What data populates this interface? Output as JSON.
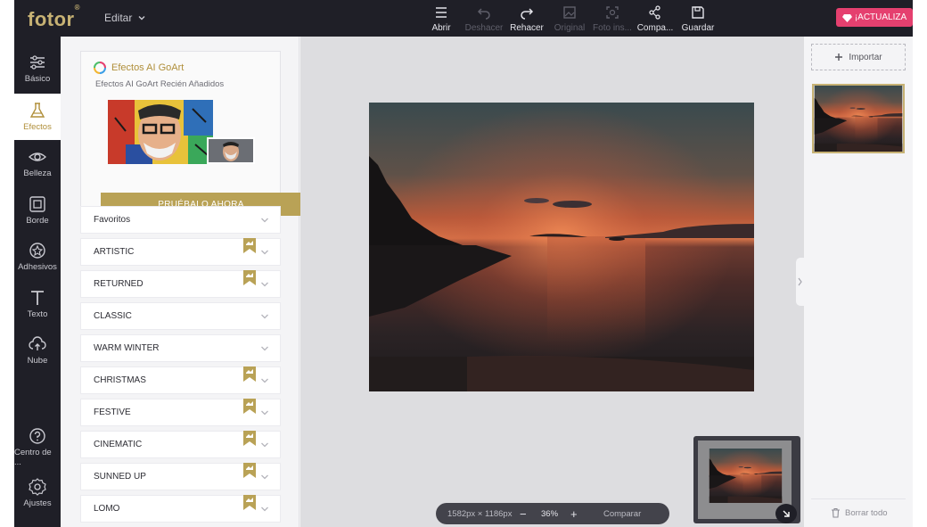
{
  "app": {
    "logo_text": "fotor",
    "logo_mark": "®",
    "edit_menu": "Editar"
  },
  "toolbar": [
    {
      "label": "Abrir",
      "icon": "menu-icon",
      "enabled": true
    },
    {
      "label": "Deshacer",
      "icon": "undo-icon",
      "enabled": false
    },
    {
      "label": "Rehacer",
      "icon": "redo-icon",
      "enabled": true
    },
    {
      "label": "Original",
      "icon": "image-icon",
      "enabled": false
    },
    {
      "label": "Foto ins...",
      "icon": "focus-icon",
      "enabled": false
    },
    {
      "label": "Compa...",
      "icon": "share-icon",
      "enabled": true
    },
    {
      "label": "Guardar",
      "icon": "save-icon",
      "enabled": true
    }
  ],
  "upgrade_label": "¡ACTUALIZA",
  "sidebar": [
    {
      "label": "Básico",
      "icon": "sliders-icon",
      "active": false
    },
    {
      "label": "Efectos",
      "icon": "flask-icon",
      "active": true
    },
    {
      "label": "Belleza",
      "icon": "eye-icon",
      "active": false
    },
    {
      "label": "Borde",
      "icon": "frame-icon",
      "active": false
    },
    {
      "label": "Adhesivos",
      "icon": "sticker-icon",
      "active": false
    },
    {
      "label": "Texto",
      "icon": "text-icon",
      "active": false
    },
    {
      "label": "Nube",
      "icon": "cloud-upload-icon",
      "active": false
    },
    {
      "label": "Centro de ...",
      "icon": "help-icon",
      "active": false
    },
    {
      "label": "Ajustes",
      "icon": "gear-icon",
      "active": false
    }
  ],
  "promo": {
    "title": "Efectos AI GoArt",
    "subtitle": "Efectos AI GoArt Recién Añadidos",
    "button": "PRUÉBALO AHORA"
  },
  "categories": [
    {
      "label": "Favoritos",
      "premium": false
    },
    {
      "label": "ARTISTIC",
      "premium": true
    },
    {
      "label": "RETURNED",
      "premium": true
    },
    {
      "label": "CLASSIC",
      "premium": false
    },
    {
      "label": "WARM WINTER",
      "premium": false
    },
    {
      "label": "CHRISTMAS",
      "premium": true
    },
    {
      "label": "FESTIVE",
      "premium": true
    },
    {
      "label": "CINEMATIC",
      "premium": true
    },
    {
      "label": "SUNNED UP",
      "premium": true
    },
    {
      "label": "LOMO",
      "premium": true
    }
  ],
  "canvas": {
    "dimensions": "1582px × 1186px",
    "zoom": "36%",
    "zoom_out": "−",
    "zoom_in": "+",
    "compare": "Comparar"
  },
  "right_panel": {
    "import_label": "Importar",
    "clear_label": "Borrar todo"
  },
  "colors": {
    "accent_gold": "#b9a256",
    "upgrade_pink": "#e5406f",
    "dark": "#1f1f27"
  }
}
